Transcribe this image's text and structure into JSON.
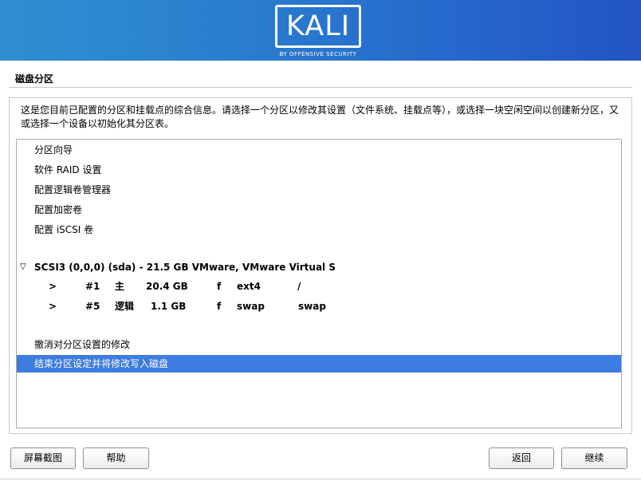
{
  "banner": {
    "logo_text": "KALI",
    "logo_sub": "BY OFFENSIVE SECURITY"
  },
  "section_title": "磁盘分区",
  "description": "这是您目前已配置的分区和挂载点的综合信息。请选择一个分区以修改其设置（文件系统、挂载点等），或选择一块空闲空间以创建新分区，又或选择一个设备以初始化其分区表。",
  "menu_items": [
    "分区向导",
    "软件 RAID 设置",
    "配置逻辑卷管理器",
    "配置加密卷",
    "配置 iSCSI 卷"
  ],
  "disk": {
    "expander_glyph": "▽",
    "label": "SCSI3 (0,0,0) (sda) - 21.5 GB VMware, VMware Virtual S"
  },
  "partitions": [
    {
      "arrow": ">",
      "number": "#1",
      "type": "主",
      "size": "20.4 GB",
      "flag": "f",
      "fs": "ext4",
      "mount": "/"
    },
    {
      "arrow": ">",
      "number": "#5",
      "type": "逻辑",
      "size": "1.1 GB",
      "flag": "f",
      "fs": "swap",
      "mount": "swap"
    }
  ],
  "actions": [
    "撤消对分区设置的修改",
    "结束分区设定并将修改写入磁盘"
  ],
  "selected_action_index": 1,
  "buttons": {
    "screenshot": "屏幕截图",
    "help": "帮助",
    "back": "返回",
    "continue": "继续"
  },
  "colors": {
    "banner_start": "#2f8fd0",
    "banner_end": "#2354c4",
    "selection": "#3d7ce0"
  }
}
